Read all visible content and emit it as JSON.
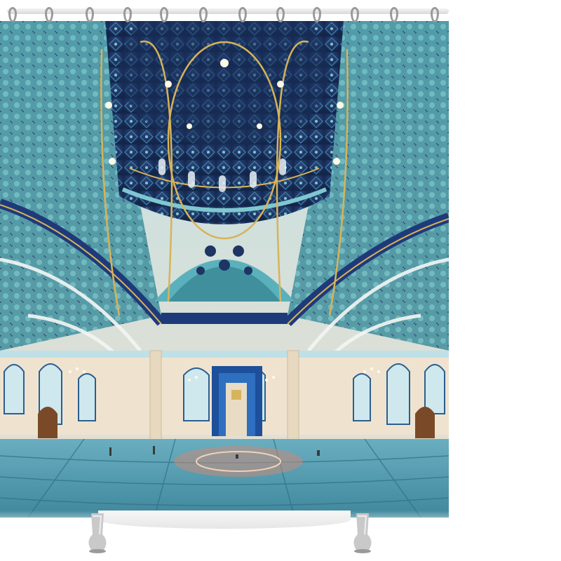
{
  "image": {
    "subject": "shower-curtain-product-photo",
    "scene": "mosque-interior-panorama",
    "colors": {
      "dome_navy": "#1e3563",
      "tile_teal": "#4fa3ad",
      "carpet_blue": "#5f9fb3",
      "gold": "#d7b35a",
      "wall_cream": "#efe3d0",
      "background": "#ffffff"
    },
    "icons": [
      "curtain-ring-icon",
      "tub-foot-icon"
    ]
  }
}
